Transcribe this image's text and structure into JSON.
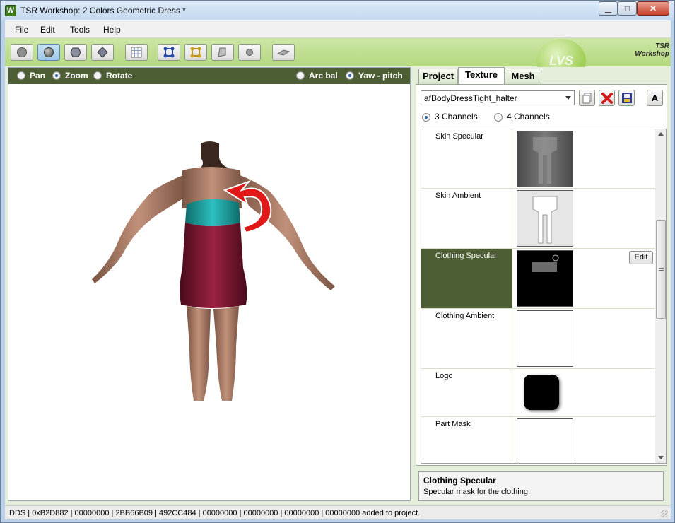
{
  "window": {
    "title": "TSR Workshop: 2 Colors Geometric Dress *"
  },
  "menu": [
    "File",
    "Edit",
    "Tools",
    "Help"
  ],
  "toolbar": {
    "buttons": [
      {
        "icon": "sphere-flat-icon"
      },
      {
        "icon": "sphere-smooth-icon"
      },
      {
        "icon": "hexagon-icon"
      },
      {
        "icon": "diamond-icon"
      },
      {
        "icon": "grid-icon"
      },
      {
        "icon": "bone-blue-icon"
      },
      {
        "icon": "bone-gold-icon"
      },
      {
        "icon": "plane-icon"
      },
      {
        "icon": "circle-icon"
      },
      {
        "icon": "floor-icon"
      }
    ],
    "badge": "LVS",
    "brand_line1": "TSR",
    "brand_line2": "Workshop"
  },
  "viewport": {
    "modes": [
      {
        "label": "Pan",
        "selected": false
      },
      {
        "label": "Zoom",
        "selected": true
      },
      {
        "label": "Rotate",
        "selected": false
      }
    ],
    "rotation_modes": [
      {
        "label": "Arc bal",
        "selected": false
      },
      {
        "label": "Yaw - pitch",
        "selected": true
      }
    ],
    "model_colors": {
      "dress": "#7a1530",
      "bust": "#1aa3a3",
      "skin": "#b07d66"
    }
  },
  "panel": {
    "tabs": [
      {
        "label": "Project",
        "selected": false
      },
      {
        "label": "Texture",
        "selected": true
      },
      {
        "label": "Mesh",
        "selected": false
      }
    ],
    "texture_select": "afBodyDressTight_halter",
    "icons": {
      "copy": "copy-icon",
      "delete": "delete-icon",
      "save": "save-icon",
      "font": "A"
    },
    "channels": [
      {
        "label": "3 Channels",
        "selected": true
      },
      {
        "label": "4 Channels",
        "selected": false
      }
    ],
    "textures": [
      {
        "name": "Skin Specular",
        "thumb": "gray-body"
      },
      {
        "name": "Skin Ambient",
        "thumb": "light-body"
      },
      {
        "name": "Clothing Specular",
        "thumb": "black-mask",
        "selected": true,
        "action": "Edit"
      },
      {
        "name": "Clothing Ambient",
        "thumb": "white"
      },
      {
        "name": "Logo",
        "thumb": "logo-black"
      },
      {
        "name": "Part Mask",
        "thumb": "white"
      }
    ],
    "description": {
      "title": "Clothing Specular",
      "text": "Specular mask for the clothing."
    }
  },
  "status": {
    "text": "DDS | 0xB2D882 | 00000000 | 2BB66B09 | 492CC484 | 00000000 | 00000000 | 00000000 | 00000000 added to project."
  }
}
